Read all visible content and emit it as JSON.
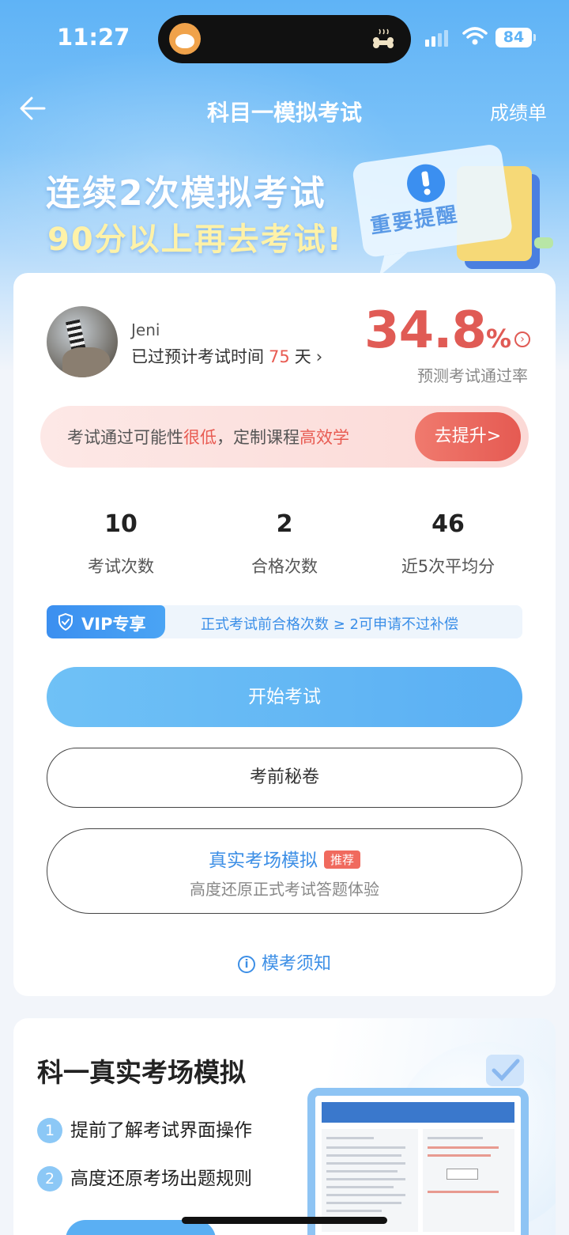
{
  "status_bar": {
    "time": "11:27",
    "battery": "84"
  },
  "nav": {
    "title": "科目一模拟考试",
    "right_link": "成绩单"
  },
  "banner": {
    "line1": "连续2次模拟考试",
    "line2": "90分以上再去考试!",
    "notice_text": "重要提醒"
  },
  "profile": {
    "username": "Jeni",
    "days_prefix": "已过预计考试时间",
    "days_value": "75",
    "days_suffix": "天",
    "pass_rate_value": "34.8",
    "pass_rate_unit": "%",
    "pass_rate_label": "预测考试通过率"
  },
  "alert": {
    "text_part1": "考试通过可能性",
    "text_highlight1": "很低",
    "text_part2": "，定制课程",
    "text_highlight2": "高效学",
    "button_label": "去提升>"
  },
  "stats": [
    {
      "value": "10",
      "label": "考试次数"
    },
    {
      "value": "2",
      "label": "合格次数"
    },
    {
      "value": "46",
      "label": "近5次平均分"
    }
  ],
  "vip": {
    "tag": "VIP专享",
    "text": "正式考试前合格次数 ≥ 2可申请不过补偿"
  },
  "buttons": {
    "start": "开始考试",
    "secret": "考前秘卷",
    "real_title": "真实考场模拟",
    "real_badge": "推荐",
    "real_sub": "高度还原正式考试答题体验"
  },
  "notice_link": "模考须知",
  "section2": {
    "title": "科一真实考场模拟",
    "points": [
      {
        "n": "1",
        "text": "提前了解考试界面操作"
      },
      {
        "n": "2",
        "text": "高度还原考场出题规则"
      }
    ]
  },
  "colors": {
    "accent_blue": "#5aaff3",
    "alert_red": "#e05b55"
  }
}
